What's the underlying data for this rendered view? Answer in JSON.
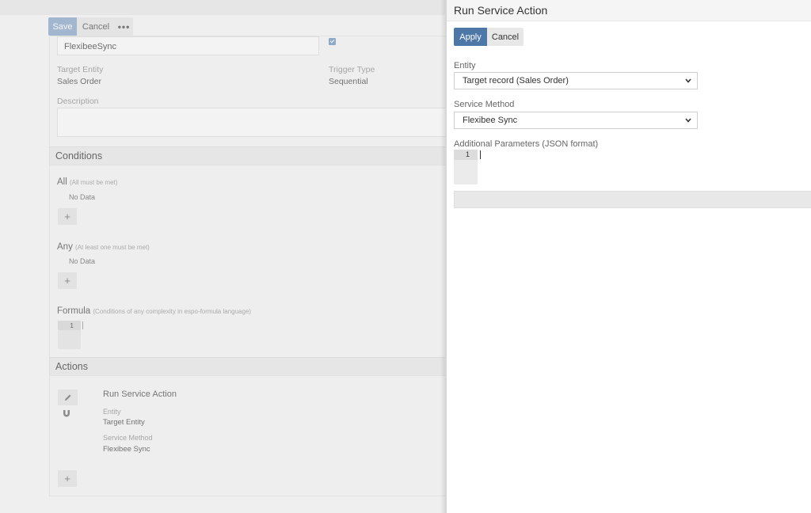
{
  "background": {
    "toolbar": {
      "save_label": "Save",
      "cancel_label": "Cancel",
      "more_label": "•••"
    },
    "name_value": "FlexibeeSync",
    "active_checked": true,
    "fields": {
      "target_entity_label": "Target Entity",
      "target_entity_value": "Sales Order",
      "trigger_type_label": "Trigger Type",
      "trigger_type_value": "Sequential",
      "description_label": "Description"
    },
    "conditions": {
      "header": "Conditions",
      "all_label": "All",
      "all_hint": "(All must be met)",
      "all_empty": "No Data",
      "any_label": "Any",
      "any_hint": "(At least one must be met)",
      "any_empty": "No Data",
      "formula_label": "Formula",
      "formula_hint": "(Conditions of any complexity in espo-formula language)",
      "formula_line": "1",
      "add_label": "+"
    },
    "actions": {
      "header": "Actions",
      "item_title": "Run Service Action",
      "entity_label": "Entity",
      "entity_value": "Target Entity",
      "method_label": "Service Method",
      "method_value": "Flexibee Sync",
      "add_label": "+"
    }
  },
  "modal": {
    "title": "Run Service Action",
    "apply_label": "Apply",
    "cancel_label": "Cancel",
    "entity_label": "Entity",
    "entity_value": "Target record (Sales Order)",
    "method_label": "Service Method",
    "method_value": "Flexibee Sync",
    "params_label": "Additional Parameters (JSON format)",
    "params_line": "1"
  },
  "colors": {
    "accent": "#4d77a7",
    "accent_faded": "#a3b6cf",
    "modal_bg": "#ffffff",
    "page_bg": "#efefef"
  },
  "icons": [
    "chevron-down-icon",
    "pencil-icon",
    "magnet-icon",
    "plus-icon",
    "ellipsis-icon"
  ]
}
